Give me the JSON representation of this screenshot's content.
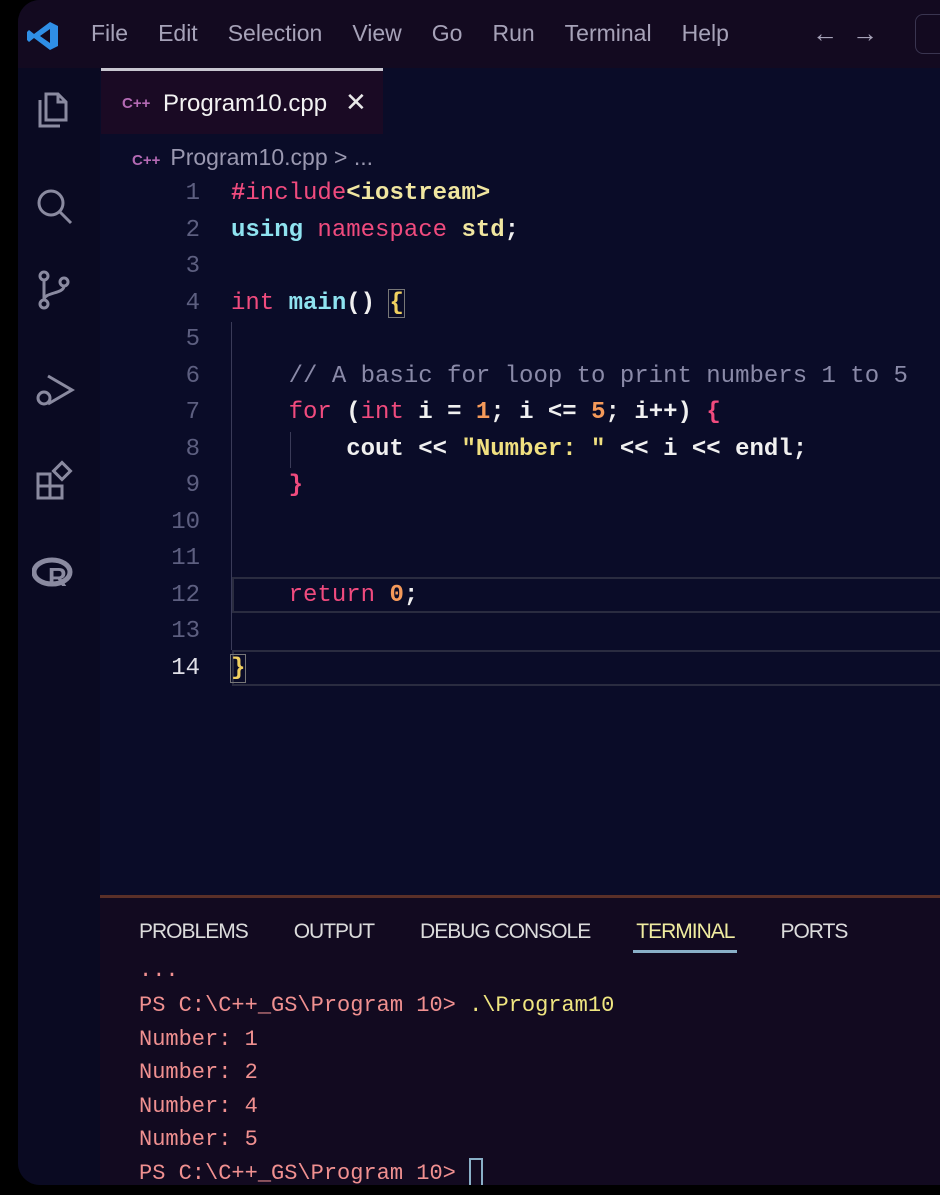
{
  "menu": [
    "File",
    "Edit",
    "Selection",
    "View",
    "Go",
    "Run",
    "Terminal",
    "Help"
  ],
  "nav": {
    "back": "←",
    "forward": "→"
  },
  "tab": {
    "icon": "C++",
    "name": "Program10.cpp",
    "close": "✕"
  },
  "breadcrumb": {
    "icon": "C++",
    "file": "Program10.cpp",
    "rest": " > ..."
  },
  "code": {
    "line_numbers": [
      "1",
      "2",
      "3",
      "4",
      "5",
      "6",
      "7",
      "8",
      "9",
      "10",
      "11",
      "12",
      "13",
      "14"
    ],
    "current_line": "14"
  },
  "panel": {
    "tabs": [
      "PROBLEMS",
      "OUTPUT",
      "DEBUG CONSOLE",
      "TERMINAL",
      "PORTS"
    ],
    "active": "TERMINAL"
  },
  "terminal": {
    "ellipsis": "...",
    "prompt1": "PS C:\\C++_GS\\Program 10> ",
    "command": ".\\Program10",
    "output": [
      "Number: 1",
      "Number: 2",
      "Number: 4",
      "Number: 5"
    ],
    "prompt2": "PS C:\\C++_GS\\Program 10> "
  },
  "colors": {
    "background": "#0a0c28",
    "keyword": "#f04b7e",
    "function": "#8fe3f0",
    "string": "#f0e080",
    "number": "#f59a5a"
  }
}
